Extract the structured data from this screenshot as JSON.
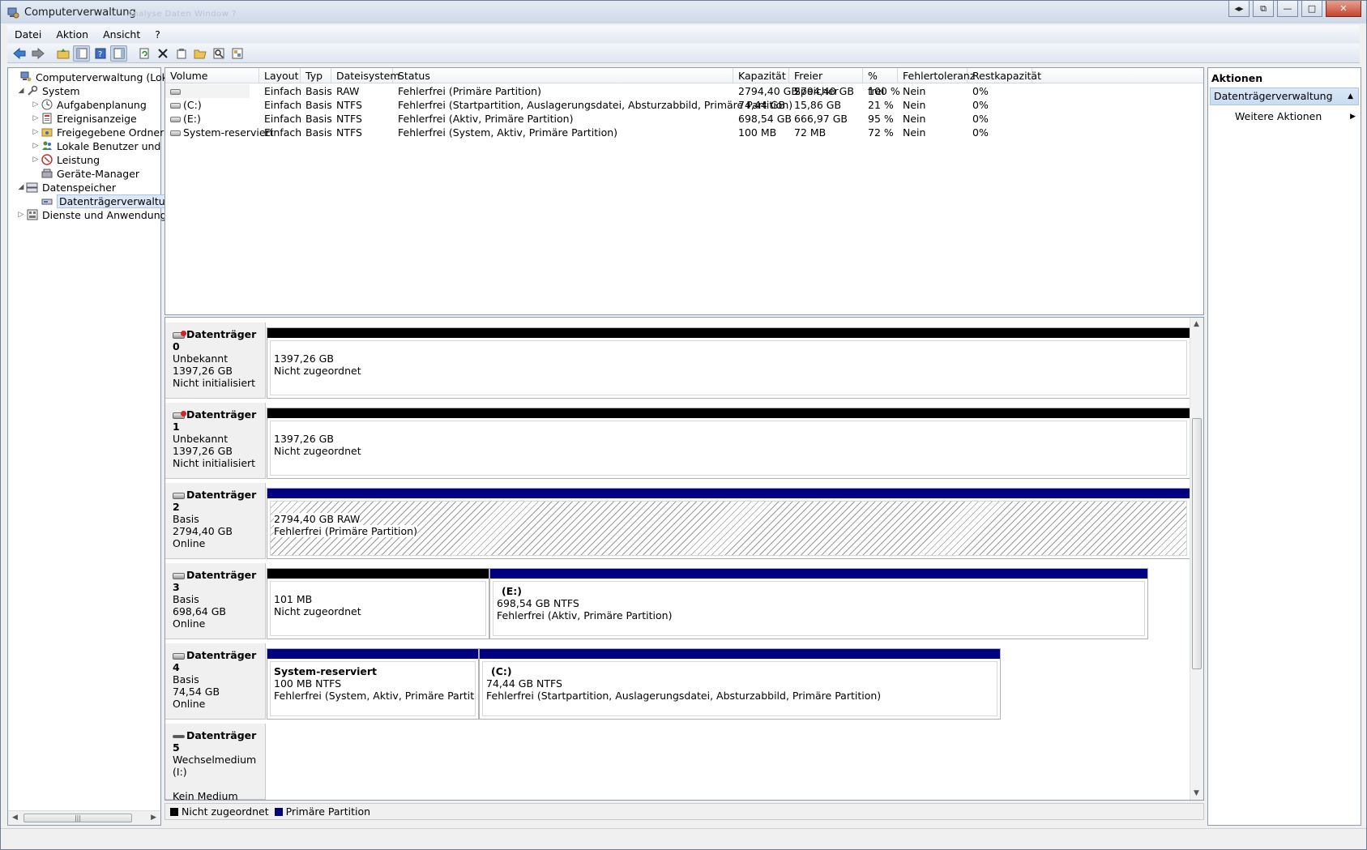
{
  "window": {
    "title": "Computerverwaltung",
    "ghost_tabs": "Analyse  Daten  Window  ?"
  },
  "menubar": {
    "items": [
      "Datei",
      "Aktion",
      "Ansicht",
      "?"
    ]
  },
  "tree": {
    "items": [
      {
        "label": "Computerverwaltung (Lokal)",
        "icon": "computer-icon"
      },
      {
        "label": "System",
        "icon": "tools-icon"
      },
      {
        "label": "Aufgabenplanung",
        "icon": "clock-icon"
      },
      {
        "label": "Ereignisanzeige",
        "icon": "event-viewer-icon"
      },
      {
        "label": "Freigegebene Ordner",
        "icon": "shared-folder-icon"
      },
      {
        "label": "Lokale Benutzer und Gr",
        "icon": "users-icon"
      },
      {
        "label": "Leistung",
        "icon": "performance-icon"
      },
      {
        "label": "Geräte-Manager",
        "icon": "device-manager-icon"
      },
      {
        "label": "Datenspeicher",
        "icon": "storage-icon"
      },
      {
        "label": "Datenträgerverwaltung",
        "icon": "disk-management-icon"
      },
      {
        "label": "Dienste und Anwendungen",
        "icon": "services-icon"
      }
    ]
  },
  "volumes": {
    "headers": [
      "Volume",
      "Layout",
      "Typ",
      "Dateisystem",
      "Status",
      "Kapazität",
      "Freier Speicher",
      "% frei",
      "Fehlertoleranz",
      "Restkapazität"
    ],
    "rows": [
      [
        "",
        "Einfach",
        "Basis",
        "RAW",
        "Fehlerfrei (Primäre Partition)",
        "2794,40 GB",
        "2794,40 GB",
        "100 %",
        "Nein",
        "0%"
      ],
      [
        "(C:)",
        "Einfach",
        "Basis",
        "NTFS",
        "Fehlerfrei (Startpartition, Auslagerungsdatei, Absturzabbild, Primäre Partition)",
        "74,44 GB",
        "15,86 GB",
        "21 %",
        "Nein",
        "0%"
      ],
      [
        "(E:)",
        "Einfach",
        "Basis",
        "NTFS",
        "Fehlerfrei (Aktiv, Primäre Partition)",
        "698,54 GB",
        "666,97 GB",
        "95 %",
        "Nein",
        "0%"
      ],
      [
        "System-reserviert",
        "Einfach",
        "Basis",
        "NTFS",
        "Fehlerfrei (System, Aktiv, Primäre Partition)",
        "100 MB",
        "72 MB",
        "72 %",
        "Nein",
        "0%"
      ]
    ]
  },
  "disks": [
    {
      "name": "Datenträger 0",
      "type": "Unbekannt",
      "size": "1397,26 GB",
      "state": "Nicht initialisiert",
      "partitions": [
        {
          "title": "",
          "line1": "1397,26 GB",
          "line2": "Nicht zugeordnet",
          "kind": "unallocated"
        }
      ]
    },
    {
      "name": "Datenträger 1",
      "type": "Unbekannt",
      "size": "1397,26 GB",
      "state": "Nicht initialisiert",
      "partitions": [
        {
          "title": "",
          "line1": "1397,26 GB",
          "line2": "Nicht zugeordnet",
          "kind": "unallocated"
        }
      ]
    },
    {
      "name": "Datenträger 2",
      "type": "Basis",
      "size": "2794,40 GB",
      "state": "Online",
      "partitions": [
        {
          "title": "",
          "line1": "2794,40 GB RAW",
          "line2": "Fehlerfrei (Primäre Partition)",
          "kind": "primary-raw"
        }
      ]
    },
    {
      "name": "Datenträger 3",
      "type": "Basis",
      "size": "698,64 GB",
      "state": "Online",
      "partitions": [
        {
          "title": "",
          "line1": "101 MB",
          "line2": "Nicht zugeordnet",
          "kind": "unallocated"
        },
        {
          "title": "(E:)",
          "line1": "698,54 GB NTFS",
          "line2": "Fehlerfrei (Aktiv, Primäre Partition)",
          "kind": "primary"
        }
      ]
    },
    {
      "name": "Datenträger 4",
      "type": "Basis",
      "size": "74,54 GB",
      "state": "Online",
      "partitions": [
        {
          "title": "System-reserviert",
          "line1": "100 MB NTFS",
          "line2": "Fehlerfrei (System, Aktiv, Primäre Partition)",
          "kind": "primary"
        },
        {
          "title": "(C:)",
          "line1": "74,44 GB NTFS",
          "line2": "Fehlerfrei (Startpartition, Auslagerungsdatei, Absturzabbild, Primäre Partition)",
          "kind": "primary"
        }
      ]
    },
    {
      "name": "Datenträger 5",
      "type": "Wechselmedium (I:)",
      "size": "",
      "state": "Kein Medium",
      "partitions": []
    }
  ],
  "legend": {
    "unallocated": "Nicht zugeordnet",
    "primary": "Primäre Partition",
    "colors": {
      "unallocated": "#000000",
      "primary": "#000080"
    }
  },
  "actions": {
    "header": "Aktionen",
    "section": "Datenträgerverwaltung",
    "item": "Weitere Aktionen"
  }
}
